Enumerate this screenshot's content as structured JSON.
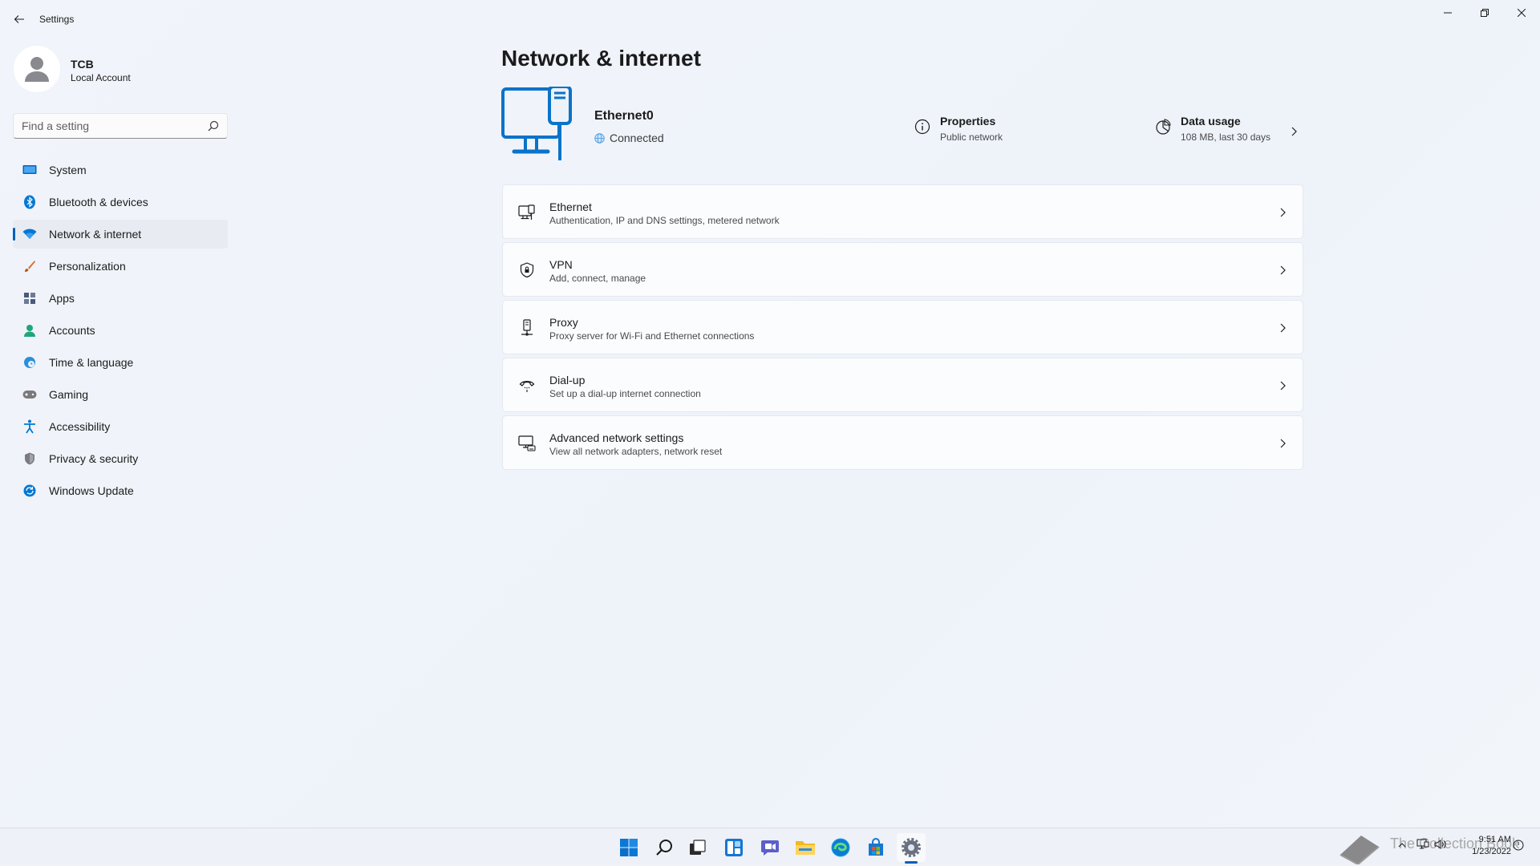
{
  "window": {
    "app_title": "Settings"
  },
  "profile": {
    "name": "TCB",
    "account_type": "Local Account"
  },
  "search": {
    "placeholder": "Find a setting",
    "value": ""
  },
  "sidebar": {
    "items": [
      {
        "label": "System",
        "icon": "system-icon",
        "color": "#0067c0",
        "active": false
      },
      {
        "label": "Bluetooth & devices",
        "icon": "bluetooth-icon",
        "color": "#0078d4",
        "active": false
      },
      {
        "label": "Network & internet",
        "icon": "wifi-icon",
        "color": "#0078d4",
        "active": true
      },
      {
        "label": "Personalization",
        "icon": "brush-icon",
        "color": "#e06c2a",
        "active": false
      },
      {
        "label": "Apps",
        "icon": "apps-icon",
        "color": "#4a5a78",
        "active": false
      },
      {
        "label": "Accounts",
        "icon": "person-icon",
        "color": "#1fa67a",
        "active": false
      },
      {
        "label": "Time & language",
        "icon": "globe-clock-icon",
        "color": "#2a8fd8",
        "active": false
      },
      {
        "label": "Gaming",
        "icon": "gamepad-icon",
        "color": "#7a7a7a",
        "active": false
      },
      {
        "label": "Accessibility",
        "icon": "accessibility-icon",
        "color": "#0078d4",
        "active": false
      },
      {
        "label": "Privacy & security",
        "icon": "shield-icon",
        "color": "#7a7a80",
        "active": false
      },
      {
        "label": "Windows Update",
        "icon": "update-icon",
        "color": "#0078d4",
        "active": false
      }
    ]
  },
  "main": {
    "title": "Network & internet",
    "hero": {
      "adapter_name": "Ethernet0",
      "status": "Connected",
      "properties_title": "Properties",
      "properties_sub": "Public network",
      "data_usage_title": "Data usage",
      "data_usage_sub": "108 MB, last 30 days"
    },
    "cards": [
      {
        "title": "Ethernet",
        "subtitle": "Authentication, IP and DNS settings, metered network",
        "icon": "ethernet-icon"
      },
      {
        "title": "VPN",
        "subtitle": "Add, connect, manage",
        "icon": "vpn-shield-icon"
      },
      {
        "title": "Proxy",
        "subtitle": "Proxy server for Wi-Fi and Ethernet connections",
        "icon": "proxy-icon"
      },
      {
        "title": "Dial-up",
        "subtitle": "Set up a dial-up internet connection",
        "icon": "dialup-icon"
      },
      {
        "title": "Advanced network settings",
        "subtitle": "View all network adapters, network reset",
        "icon": "advanced-network-icon"
      }
    ]
  },
  "taskbar": {
    "apps": [
      "start-icon",
      "search-icon",
      "task-view-icon",
      "widgets-icon",
      "chat-icon",
      "file-explorer-icon",
      "edge-icon",
      "store-icon",
      "settings-icon"
    ],
    "clock_time": "9:51 AM",
    "clock_date": "1/23/2022",
    "watermark": "The Collection Book"
  },
  "colors": {
    "accent": "#005fb8",
    "icon_blue": "#0078d4"
  }
}
